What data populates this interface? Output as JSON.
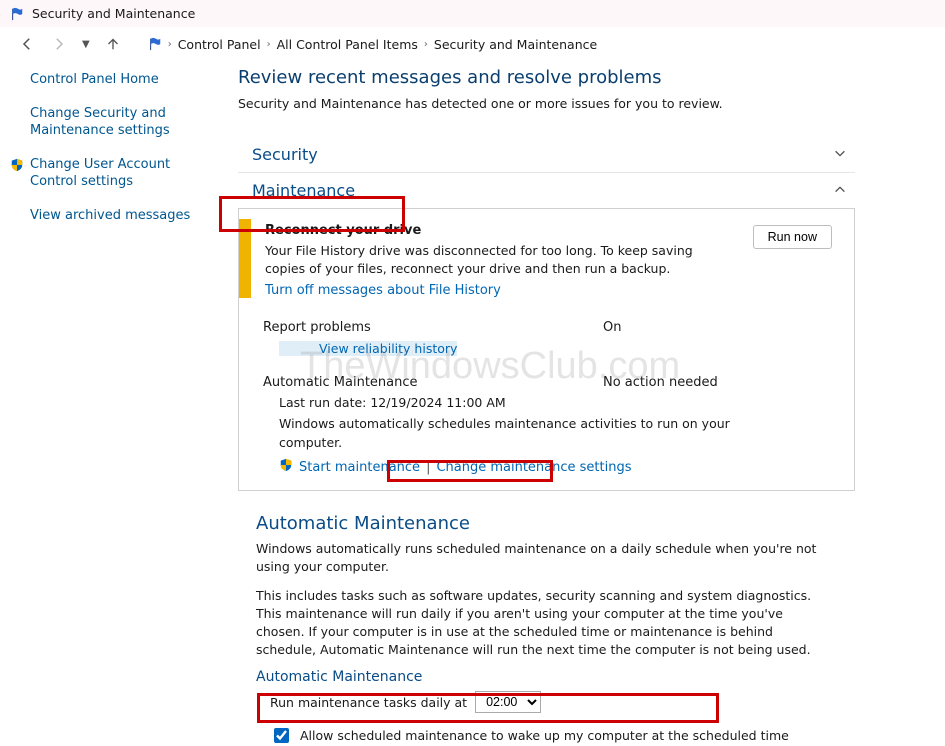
{
  "titlebar": {
    "title": "Security and Maintenance"
  },
  "breadcrumb": {
    "items": [
      "Control Panel",
      "All Control Panel Items",
      "Security and Maintenance"
    ]
  },
  "sidebar": {
    "items": [
      "Control Panel Home",
      "Change Security and Maintenance settings",
      "Change User Account Control settings",
      "View archived messages"
    ]
  },
  "main": {
    "heading": "Review recent messages and resolve problems",
    "sub": "Security and Maintenance has detected one or more issues for you to review.",
    "sections": {
      "security": "Security",
      "maintenance": "Maintenance"
    },
    "reconnect": {
      "title": "Reconnect your drive",
      "text": "Your File History drive was disconnected for too long. To keep saving copies of your files, reconnect your drive and then run a backup.",
      "turn_off": "Turn off messages about File History",
      "run_now": "Run now"
    },
    "report": {
      "label": "Report problems",
      "value": "On",
      "reliability": "View reliability history"
    },
    "automaint": {
      "label": "Automatic Maintenance",
      "value": "No action needed",
      "lastrun": "Last run date: 12/19/2024 11:00 AM",
      "desc": "Windows automatically schedules maintenance activities to run on your computer.",
      "start": "Start maintenance",
      "change": "Change maintenance settings"
    },
    "lower": {
      "heading": "Automatic Maintenance",
      "p1": "Windows automatically runs scheduled maintenance on a daily schedule when you're not using your computer.",
      "p2": "This includes tasks such as software updates, security scanning and system diagnostics. This maintenance will run daily if you aren't using your computer at the time you've chosen. If your computer is in use at the scheduled time or maintenance is behind schedule, Automatic Maintenance will run the next time the computer is not being used.",
      "subhead": "Automatic Maintenance",
      "run_label": "Run maintenance tasks daily at",
      "run_value": "02:00",
      "cb_label": "Allow scheduled maintenance to wake up my computer at the scheduled time"
    }
  },
  "watermark": "TheWindowsClub.com"
}
